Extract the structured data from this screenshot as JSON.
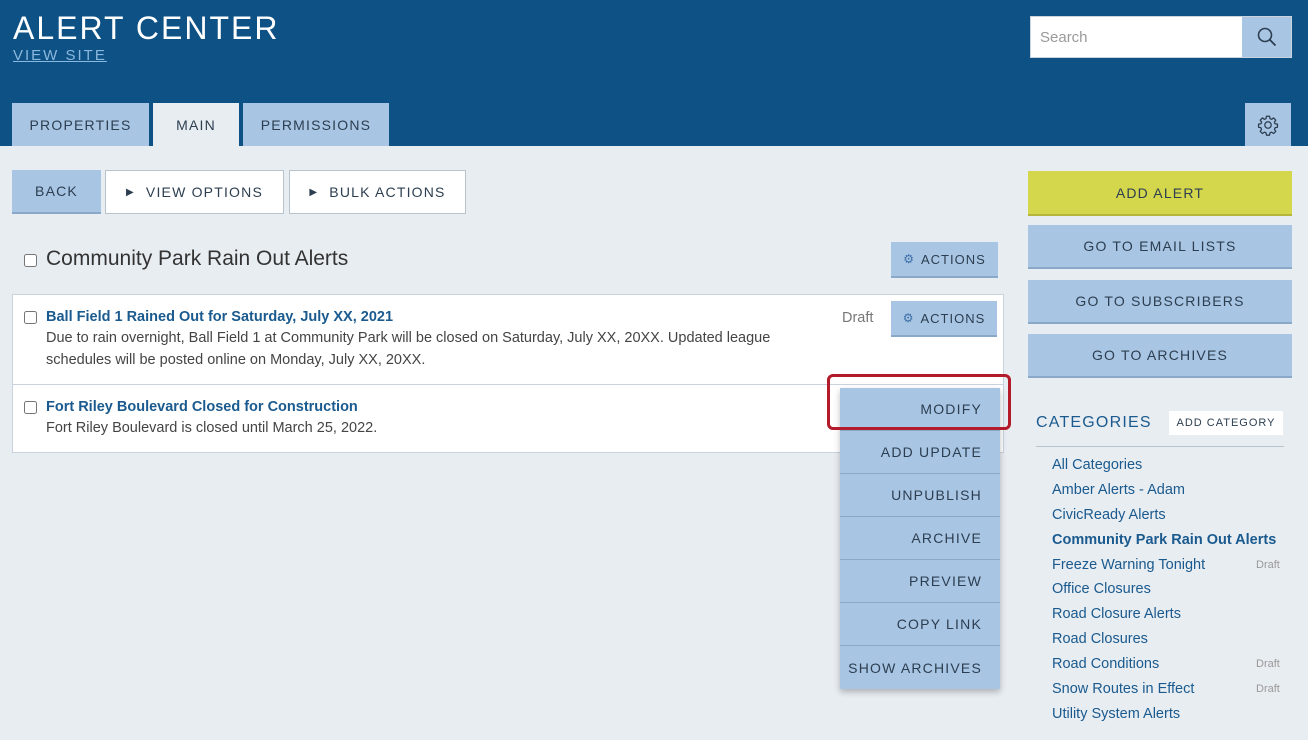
{
  "header": {
    "title": "ALERT CENTER",
    "view_site": "VIEW SITE",
    "search_placeholder": "Search"
  },
  "tabs": [
    {
      "label": "PROPERTIES",
      "active": false
    },
    {
      "label": "MAIN",
      "active": true
    },
    {
      "label": "PERMISSIONS",
      "active": false
    }
  ],
  "toolbar": {
    "back": "BACK",
    "view_options": "VIEW OPTIONS",
    "bulk_actions": "BULK ACTIONS"
  },
  "section": {
    "title": "Community Park Rain Out Alerts",
    "actions": "ACTIONS"
  },
  "alerts": [
    {
      "title": "Ball Field 1 Rained Out for Saturday, July XX, 2021",
      "body_line1": "Due to rain overnight, Ball Field 1 at Community Park will be closed on Saturday, July XX, 20XX. Updated league",
      "body_line2": "schedules will be posted online on Monday, July XX, 20XX.",
      "status": "Draft",
      "actions": "ACTIONS"
    },
    {
      "title": "Fort Riley Boulevard Closed for Construction",
      "body_line1": "Fort Riley Boulevard is closed until March 25, 2022."
    }
  ],
  "dropdown": {
    "items": [
      "MODIFY",
      "ADD UPDATE",
      "UNPUBLISH",
      "ARCHIVE",
      "PREVIEW",
      "COPY LINK",
      "SHOW ARCHIVES"
    ]
  },
  "sidebar": {
    "add_alert": "ADD ALERT",
    "go_email_lists": "GO TO EMAIL LISTS",
    "go_subscribers": "GO TO SUBSCRIBERS",
    "go_archives": "GO TO ARCHIVES",
    "categories_heading": "CATEGORIES",
    "add_category": "ADD CATEGORY",
    "categories": [
      {
        "label": "All Categories",
        "draft": ""
      },
      {
        "label": "Amber Alerts - Adam",
        "draft": ""
      },
      {
        "label": "CivicReady Alerts",
        "draft": ""
      },
      {
        "label": "Community Park Rain Out Alerts",
        "draft": "",
        "active": true
      },
      {
        "label": "Freeze Warning Tonight",
        "draft": "Draft"
      },
      {
        "label": "Office Closures",
        "draft": ""
      },
      {
        "label": "Road Closure Alerts",
        "draft": ""
      },
      {
        "label": "Road Closures",
        "draft": ""
      },
      {
        "label": "Road Conditions",
        "draft": "Draft"
      },
      {
        "label": "Snow Routes in Effect",
        "draft": "Draft"
      },
      {
        "label": "Utility System Alerts",
        "draft": ""
      }
    ]
  },
  "colors": {
    "header_bg": "#0d5185",
    "button_blue": "#a9c5e4",
    "add_alert_yellow": "#d4d64c",
    "highlight_red": "#b31b2a",
    "link_blue": "#1a5a8e"
  }
}
